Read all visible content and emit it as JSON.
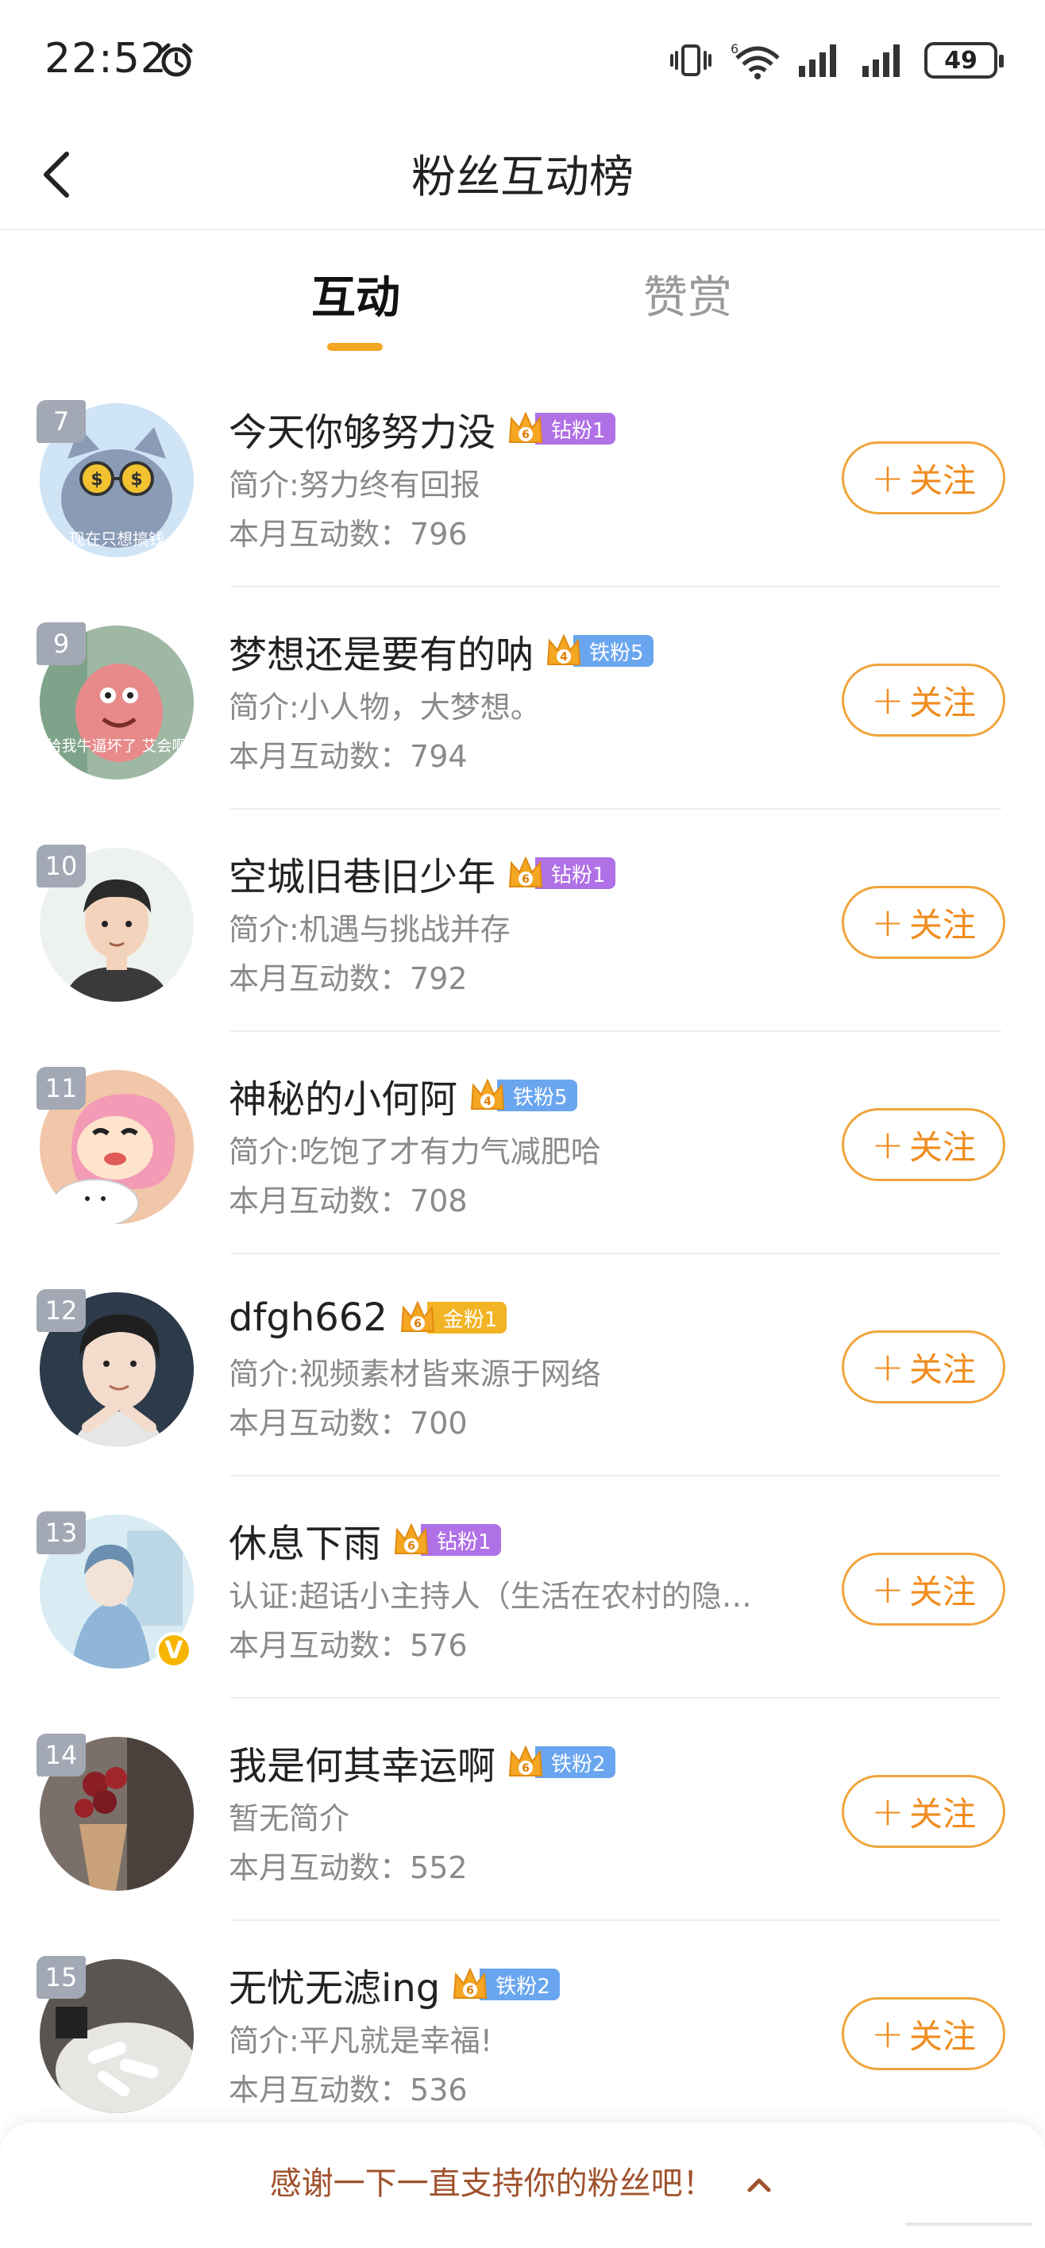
{
  "status_bar": {
    "time": "22:52",
    "battery": "49",
    "network_label": "6"
  },
  "header": {
    "title": "粉丝互动榜"
  },
  "tabs": [
    {
      "label": "互动",
      "active": true
    },
    {
      "label": "赞赏",
      "active": false
    }
  ],
  "follow_label": "关注",
  "follow_plus": "+",
  "fans": [
    {
      "rank": "7",
      "name": "今天你够努力没",
      "badge": "钻粉1",
      "badge_level": "6",
      "badge_color": "#b070e6",
      "bio": "简介:努力终有回报",
      "count_label": "本月互动数：",
      "count": "796",
      "avatar_text": "现在只想搞钱"
    },
    {
      "rank": "9",
      "name": "梦想还是要有的呐",
      "badge": "铁粉5",
      "badge_level": "4",
      "badge_color": "#6aa6ef",
      "bio": "简介:小人物，大梦想。",
      "count_label": "本月互动数：",
      "count": "794",
      "avatar_text": "给我牛逼坏了 艾会啊"
    },
    {
      "rank": "10",
      "name": "空城旧巷旧少年",
      "badge": "钻粉1",
      "badge_level": "6",
      "badge_color": "#b070e6",
      "bio": "简介:机遇与挑战并存",
      "count_label": "本月互动数：",
      "count": "792"
    },
    {
      "rank": "11",
      "name": "神秘的小何阿",
      "badge": "铁粉5",
      "badge_level": "4",
      "badge_color": "#6aa6ef",
      "bio": "简介:吃饱了才有力气减肥哈",
      "count_label": "本月互动数：",
      "count": "708"
    },
    {
      "rank": "12",
      "name": "dfgh662",
      "badge": "金粉1",
      "badge_level": "6",
      "badge_color": "#f2b324",
      "bio": "简介:视频素材皆来源于网络",
      "count_label": "本月互动数：",
      "count": "700"
    },
    {
      "rank": "13",
      "name": "休息下雨",
      "badge": "钻粉1",
      "badge_level": "6",
      "badge_color": "#b070e6",
      "bio": "认证:超话小主持人（生活在农村的隐…",
      "count_label": "本月互动数：",
      "count": "576",
      "verified": "V"
    },
    {
      "rank": "14",
      "name": "我是何其幸运啊",
      "badge": "铁粉2",
      "badge_level": "6",
      "badge_color": "#6aa6ef",
      "bio": "暂无简介",
      "count_label": "本月互动数：",
      "count": "552"
    },
    {
      "rank": "15",
      "name": "无忧无滤ing",
      "badge": "铁粉2",
      "badge_level": "6",
      "badge_color": "#6aa6ef",
      "bio": "简介:平凡就是幸福!",
      "count_label": "本月互动数：",
      "count": "536"
    }
  ],
  "bottom_bar": {
    "text": "感谢一下一直支持你的粉丝吧！"
  }
}
